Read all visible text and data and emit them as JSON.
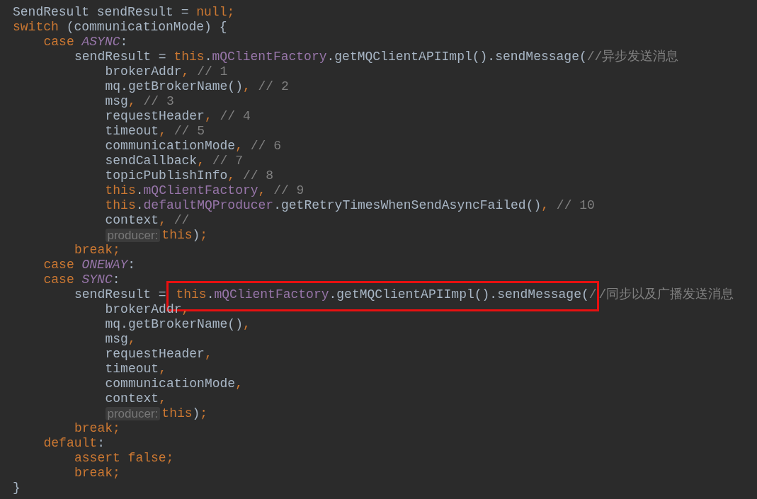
{
  "lines": [
    {
      "tokens": [
        {
          "kind": "plain",
          "text": "SendResult sendResult = "
        },
        {
          "kind": "keyword",
          "text": "null;"
        }
      ]
    },
    {
      "tokens": [
        {
          "kind": "keyword",
          "text": "switch "
        },
        {
          "kind": "plain",
          "text": "(communicationMode) {"
        }
      ],
      "children": [
        {
          "tokens": [
            {
              "kind": "keyword",
              "text": "case "
            },
            {
              "kind": "constant",
              "text": "ASYNC"
            },
            {
              "kind": "plain",
              "text": ":"
            }
          ],
          "children": [
            {
              "tokens": [
                {
                  "kind": "plain",
                  "text": "sendResult = "
                },
                {
                  "kind": "keyword",
                  "text": "this"
                },
                {
                  "kind": "plain",
                  "text": "."
                },
                {
                  "kind": "field",
                  "text": "mQClientFactory"
                },
                {
                  "kind": "plain",
                  "text": ".getMQClientAPIImpl().sendMessage("
                },
                {
                  "kind": "comment",
                  "text": "//异步发送消息"
                }
              ],
              "children": [
                {
                  "tokens": [
                    {
                      "kind": "plain",
                      "text": "brokerAddr"
                    },
                    {
                      "kind": "keyword",
                      "text": ", "
                    },
                    {
                      "kind": "comment",
                      "text": "// 1"
                    }
                  ]
                },
                {
                  "tokens": [
                    {
                      "kind": "plain",
                      "text": "mq.getBrokerName()"
                    },
                    {
                      "kind": "keyword",
                      "text": ", "
                    },
                    {
                      "kind": "comment",
                      "text": "// 2"
                    }
                  ]
                },
                {
                  "tokens": [
                    {
                      "kind": "plain",
                      "text": "msg"
                    },
                    {
                      "kind": "keyword",
                      "text": ", "
                    },
                    {
                      "kind": "comment",
                      "text": "// 3"
                    }
                  ]
                },
                {
                  "tokens": [
                    {
                      "kind": "plain",
                      "text": "requestHeader"
                    },
                    {
                      "kind": "keyword",
                      "text": ", "
                    },
                    {
                      "kind": "comment",
                      "text": "// 4"
                    }
                  ]
                },
                {
                  "tokens": [
                    {
                      "kind": "plain",
                      "text": "timeout"
                    },
                    {
                      "kind": "keyword",
                      "text": ", "
                    },
                    {
                      "kind": "comment",
                      "text": "// 5"
                    }
                  ]
                },
                {
                  "tokens": [
                    {
                      "kind": "plain",
                      "text": "communicationMode"
                    },
                    {
                      "kind": "keyword",
                      "text": ", "
                    },
                    {
                      "kind": "comment",
                      "text": "// 6"
                    }
                  ]
                },
                {
                  "tokens": [
                    {
                      "kind": "plain",
                      "text": "sendCallback"
                    },
                    {
                      "kind": "keyword",
                      "text": ", "
                    },
                    {
                      "kind": "comment",
                      "text": "// 7"
                    }
                  ]
                },
                {
                  "tokens": [
                    {
                      "kind": "plain",
                      "text": "topicPublishInfo"
                    },
                    {
                      "kind": "keyword",
                      "text": ", "
                    },
                    {
                      "kind": "comment",
                      "text": "// 8"
                    }
                  ]
                },
                {
                  "tokens": [
                    {
                      "kind": "keyword",
                      "text": "this"
                    },
                    {
                      "kind": "plain",
                      "text": "."
                    },
                    {
                      "kind": "field",
                      "text": "mQClientFactory"
                    },
                    {
                      "kind": "keyword",
                      "text": ", "
                    },
                    {
                      "kind": "comment",
                      "text": "// 9"
                    }
                  ]
                },
                {
                  "tokens": [
                    {
                      "kind": "keyword",
                      "text": "this"
                    },
                    {
                      "kind": "plain",
                      "text": "."
                    },
                    {
                      "kind": "field",
                      "text": "defaultMQProducer"
                    },
                    {
                      "kind": "plain",
                      "text": ".getRetryTimesWhenSendAsyncFailed()"
                    },
                    {
                      "kind": "keyword",
                      "text": ", "
                    },
                    {
                      "kind": "comment",
                      "text": "// 10"
                    }
                  ]
                },
                {
                  "tokens": [
                    {
                      "kind": "plain",
                      "text": "context"
                    },
                    {
                      "kind": "keyword",
                      "text": ", "
                    },
                    {
                      "kind": "comment",
                      "text": "//"
                    }
                  ]
                },
                {
                  "tokens": [
                    {
                      "kind": "hint",
                      "text": "producer:"
                    },
                    {
                      "kind": "keyword",
                      "text": "this"
                    },
                    {
                      "kind": "plain",
                      "text": ")"
                    },
                    {
                      "kind": "keyword",
                      "text": ";"
                    }
                  ]
                }
              ]
            },
            {
              "tokens": [
                {
                  "kind": "keyword",
                  "text": "break;"
                }
              ]
            }
          ]
        },
        {
          "tokens": [
            {
              "kind": "keyword",
              "text": "case "
            },
            {
              "kind": "constant",
              "text": "ONEWAY"
            },
            {
              "kind": "plain",
              "text": ":"
            }
          ]
        },
        {
          "tokens": [
            {
              "kind": "keyword",
              "text": "case "
            },
            {
              "kind": "constant",
              "text": "SYNC"
            },
            {
              "kind": "plain",
              "text": ":"
            }
          ],
          "children": [
            {
              "tokens": [
                {
                  "kind": "plain",
                  "text": "sendResult = "
                },
                {
                  "kind": "keyword",
                  "text": "this",
                  "boxed": true
                },
                {
                  "kind": "plain",
                  "text": ".",
                  "boxed": true
                },
                {
                  "kind": "field",
                  "text": "mQClientFactory",
                  "boxed": true
                },
                {
                  "kind": "plain",
                  "text": ".getMQClientAPIImpl().sendMessage(",
                  "boxed": true
                },
                {
                  "kind": "comment",
                  "text": "/",
                  "boxed": true
                },
                {
                  "kind": "comment",
                  "text": "/同步以及广播发送消息"
                }
              ],
              "children": [
                {
                  "tokens": [
                    {
                      "kind": "plain",
                      "text": "brokerAddr"
                    },
                    {
                      "kind": "keyword",
                      "text": ","
                    }
                  ]
                },
                {
                  "tokens": [
                    {
                      "kind": "plain",
                      "text": "mq.getBrokerName()"
                    },
                    {
                      "kind": "keyword",
                      "text": ","
                    }
                  ]
                },
                {
                  "tokens": [
                    {
                      "kind": "plain",
                      "text": "msg"
                    },
                    {
                      "kind": "keyword",
                      "text": ","
                    }
                  ]
                },
                {
                  "tokens": [
                    {
                      "kind": "plain",
                      "text": "requestHeader"
                    },
                    {
                      "kind": "keyword",
                      "text": ","
                    }
                  ]
                },
                {
                  "tokens": [
                    {
                      "kind": "plain",
                      "text": "timeout"
                    },
                    {
                      "kind": "keyword",
                      "text": ","
                    }
                  ]
                },
                {
                  "tokens": [
                    {
                      "kind": "plain",
                      "text": "communicationMode"
                    },
                    {
                      "kind": "keyword",
                      "text": ","
                    }
                  ]
                },
                {
                  "tokens": [
                    {
                      "kind": "plain",
                      "text": "context"
                    },
                    {
                      "kind": "keyword",
                      "text": ","
                    }
                  ]
                },
                {
                  "tokens": [
                    {
                      "kind": "hint",
                      "text": "producer:"
                    },
                    {
                      "kind": "keyword",
                      "text": "this"
                    },
                    {
                      "kind": "plain",
                      "text": ")"
                    },
                    {
                      "kind": "keyword",
                      "text": ";"
                    }
                  ]
                }
              ]
            },
            {
              "tokens": [
                {
                  "kind": "keyword",
                  "text": "break;"
                }
              ]
            }
          ]
        },
        {
          "tokens": [
            {
              "kind": "keyword",
              "text": "default"
            },
            {
              "kind": "plain",
              "text": ":"
            }
          ],
          "children": [
            {
              "tokens": [
                {
                  "kind": "keyword",
                  "text": "assert false;"
                }
              ]
            },
            {
              "tokens": [
                {
                  "kind": "keyword",
                  "text": "break;"
                }
              ]
            }
          ]
        }
      ]
    },
    {
      "tokens": [
        {
          "kind": "plain",
          "text": "}"
        }
      ]
    }
  ]
}
